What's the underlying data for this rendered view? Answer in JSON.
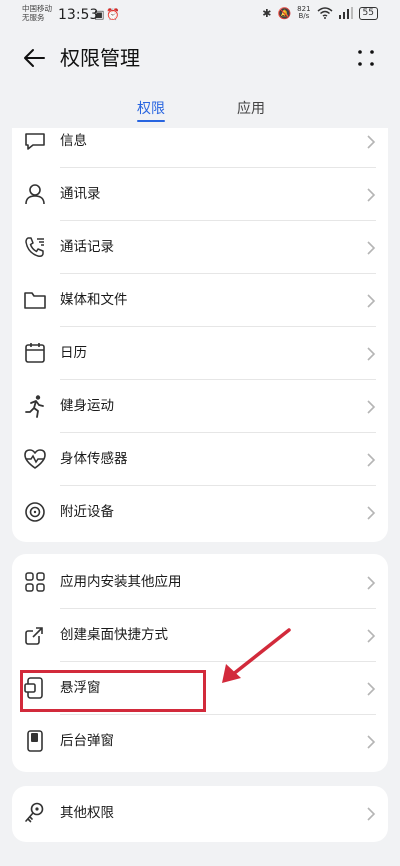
{
  "status_bar": {
    "carrier_line1": "中国移动",
    "carrier_line2": "无服务",
    "time": "13:53",
    "net_speed": "821",
    "net_speed_unit": "B/s",
    "battery": "55"
  },
  "header": {
    "title": "权限管理"
  },
  "tabs": [
    {
      "label": "权限",
      "active": true
    },
    {
      "label": "应用",
      "active": false
    }
  ],
  "permissions": {
    "partial_top_label": "信息",
    "items": [
      {
        "label": "通讯录",
        "icon": "contacts-icon"
      },
      {
        "label": "通话记录",
        "icon": "call-log-icon"
      },
      {
        "label": "媒体和文件",
        "icon": "folder-icon"
      },
      {
        "label": "日历",
        "icon": "calendar-icon"
      },
      {
        "label": "健身运动",
        "icon": "running-icon"
      },
      {
        "label": "身体传感器",
        "icon": "heart-rate-icon"
      },
      {
        "label": "附近设备",
        "icon": "nearby-devices-icon"
      }
    ]
  },
  "special": {
    "items": [
      {
        "label": "应用内安装其他应用",
        "icon": "install-apps-icon"
      },
      {
        "label": "创建桌面快捷方式",
        "icon": "shortcut-icon"
      },
      {
        "label": "悬浮窗",
        "icon": "floating-window-icon"
      },
      {
        "label": "后台弹窗",
        "icon": "background-popup-icon"
      }
    ]
  },
  "other": {
    "items": [
      {
        "label": "其他权限",
        "icon": "key-icon"
      }
    ]
  },
  "annotation": {
    "highlight_color": "#d22a3b",
    "highlighted_item": "悬浮窗"
  },
  "colors": {
    "accent": "#2865e0",
    "background": "#f1f2f4",
    "card": "#ffffff"
  }
}
